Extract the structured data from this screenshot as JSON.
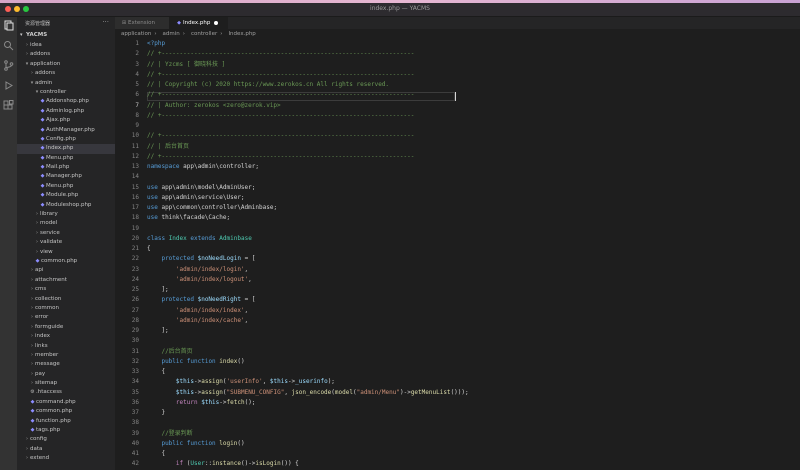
{
  "window": {
    "title": "index.php — YACMS"
  },
  "activity_icons": [
    "files-icon",
    "search-icon",
    "source-control-icon",
    "run-debug-icon",
    "extensions-icon"
  ],
  "sidebar": {
    "title": "资源管理器",
    "root": "YACMS",
    "items": [
      {
        "label": "idea",
        "depth": 1,
        "type": "folder",
        "open": false
      },
      {
        "label": "addons",
        "depth": 1,
        "type": "folder",
        "open": false
      },
      {
        "label": "application",
        "depth": 1,
        "type": "folder",
        "open": true
      },
      {
        "label": "addons",
        "depth": 2,
        "type": "folder",
        "open": false
      },
      {
        "label": "admin",
        "depth": 2,
        "type": "folder",
        "open": true
      },
      {
        "label": "controller",
        "depth": 3,
        "type": "folder",
        "open": true
      },
      {
        "label": "Addonshop.php",
        "depth": 4,
        "type": "php"
      },
      {
        "label": "Adminlog.php",
        "depth": 4,
        "type": "php"
      },
      {
        "label": "Ajax.php",
        "depth": 4,
        "type": "php"
      },
      {
        "label": "AuthManager.php",
        "depth": 4,
        "type": "php"
      },
      {
        "label": "Config.php",
        "depth": 4,
        "type": "php"
      },
      {
        "label": "Index.php",
        "depth": 4,
        "type": "php",
        "selected": true
      },
      {
        "label": "Menu.php",
        "depth": 4,
        "type": "php"
      },
      {
        "label": "Mail.php",
        "depth": 4,
        "type": "php"
      },
      {
        "label": "Manager.php",
        "depth": 4,
        "type": "php"
      },
      {
        "label": "Menu.php",
        "depth": 4,
        "type": "php"
      },
      {
        "label": "Module.php",
        "depth": 4,
        "type": "php"
      },
      {
        "label": "Moduleshop.php",
        "depth": 4,
        "type": "php"
      },
      {
        "label": "library",
        "depth": 3,
        "type": "folder",
        "open": false
      },
      {
        "label": "model",
        "depth": 3,
        "type": "folder",
        "open": false
      },
      {
        "label": "service",
        "depth": 3,
        "type": "folder",
        "open": false
      },
      {
        "label": "validate",
        "depth": 3,
        "type": "folder",
        "open": false
      },
      {
        "label": "view",
        "depth": 3,
        "type": "folder",
        "open": false
      },
      {
        "label": "common.php",
        "depth": 3,
        "type": "php"
      },
      {
        "label": "api",
        "depth": 2,
        "type": "folder",
        "open": false
      },
      {
        "label": "attachment",
        "depth": 2,
        "type": "folder",
        "open": false
      },
      {
        "label": "cms",
        "depth": 2,
        "type": "folder",
        "open": false
      },
      {
        "label": "collection",
        "depth": 2,
        "type": "folder",
        "open": false
      },
      {
        "label": "common",
        "depth": 2,
        "type": "folder",
        "open": false
      },
      {
        "label": "error",
        "depth": 2,
        "type": "folder",
        "open": false
      },
      {
        "label": "formguide",
        "depth": 2,
        "type": "folder",
        "open": false
      },
      {
        "label": "index",
        "depth": 2,
        "type": "folder",
        "open": false
      },
      {
        "label": "links",
        "depth": 2,
        "type": "folder",
        "open": false
      },
      {
        "label": "member",
        "depth": 2,
        "type": "folder",
        "open": false
      },
      {
        "label": "message",
        "depth": 2,
        "type": "folder",
        "open": false
      },
      {
        "label": "pay",
        "depth": 2,
        "type": "folder",
        "open": false
      },
      {
        "label": "sitemap",
        "depth": 2,
        "type": "folder",
        "open": false
      },
      {
        "label": ".htaccess",
        "depth": 2,
        "type": "file"
      },
      {
        "label": "command.php",
        "depth": 2,
        "type": "php"
      },
      {
        "label": "common.php",
        "depth": 2,
        "type": "php"
      },
      {
        "label": "function.php",
        "depth": 2,
        "type": "php"
      },
      {
        "label": "tags.php",
        "depth": 2,
        "type": "php"
      },
      {
        "label": "config",
        "depth": 1,
        "type": "folder",
        "open": false
      },
      {
        "label": "data",
        "depth": 1,
        "type": "folder",
        "open": false
      },
      {
        "label": "extend",
        "depth": 1,
        "type": "folder",
        "open": false
      }
    ]
  },
  "tabs": [
    {
      "label": "Extension",
      "active": false,
      "modified": false
    },
    {
      "label": "Index.php",
      "active": true,
      "modified": true
    }
  ],
  "breadcrumb": [
    "application",
    "admin",
    "controller",
    "Index.php"
  ],
  "colors": {
    "keyword": "#569cd6",
    "control": "#c586c0",
    "string": "#ce9178",
    "comment": "#6a9955",
    "variable": "#9cdcfe",
    "class": "#4ec9b0",
    "function": "#dcdcaa",
    "text": "#d4d4d4"
  },
  "editor": {
    "active_line": 6,
    "lines": [
      {
        "n": "1",
        "tokens": [
          [
            "keyword",
            "<?php"
          ]
        ]
      },
      {
        "n": "2",
        "tokens": [
          [
            "comment",
            "// +----------------------------------------------------------------------"
          ]
        ]
      },
      {
        "n": "3",
        "tokens": [
          [
            "comment",
            "// | Yzcms [ 御晓科技 ]"
          ]
        ]
      },
      {
        "n": "4",
        "tokens": [
          [
            "comment",
            "// +----------------------------------------------------------------------"
          ]
        ]
      },
      {
        "n": "5",
        "tokens": [
          [
            "comment",
            "// | Copyright (c) 2020 https://www.zerokos.cn All rights reserved."
          ]
        ]
      },
      {
        "n": "6",
        "tokens": [
          [
            "comment",
            "// +----------------------------------------------------------------------"
          ]
        ]
      },
      {
        "n": "7",
        "tokens": [
          [
            "comment",
            "// | Author: zerokos <zero@zerok.vip>"
          ]
        ]
      },
      {
        "n": "8",
        "tokens": [
          [
            "comment",
            "// +----------------------------------------------------------------------"
          ]
        ]
      },
      {
        "n": "9",
        "tokens": []
      },
      {
        "n": "10",
        "tokens": [
          [
            "comment",
            "// +----------------------------------------------------------------------"
          ]
        ]
      },
      {
        "n": "11",
        "tokens": [
          [
            "comment",
            "// | 后台首页"
          ]
        ]
      },
      {
        "n": "12",
        "tokens": [
          [
            "comment",
            "// +----------------------------------------------------------------------"
          ]
        ]
      },
      {
        "n": "13",
        "tokens": [
          [
            "keyword",
            "namespace"
          ],
          [
            "text",
            " app\\admin\\controller;"
          ]
        ]
      },
      {
        "n": "14",
        "tokens": []
      },
      {
        "n": "15",
        "tokens": [
          [
            "keyword",
            "use"
          ],
          [
            "text",
            " app\\admin\\model\\AdminUser;"
          ]
        ]
      },
      {
        "n": "16",
        "tokens": [
          [
            "keyword",
            "use"
          ],
          [
            "text",
            " app\\admin\\service\\User;"
          ]
        ]
      },
      {
        "n": "17",
        "tokens": [
          [
            "keyword",
            "use"
          ],
          [
            "text",
            " app\\common\\controller\\Adminbase;"
          ]
        ]
      },
      {
        "n": "18",
        "tokens": [
          [
            "keyword",
            "use"
          ],
          [
            "text",
            " think\\facade\\Cache;"
          ]
        ]
      },
      {
        "n": "19",
        "tokens": []
      },
      {
        "n": "20",
        "tokens": [
          [
            "keyword",
            "class"
          ],
          [
            "text",
            " "
          ],
          [
            "class",
            "Index"
          ],
          [
            "text",
            " "
          ],
          [
            "keyword",
            "extends"
          ],
          [
            "text",
            " "
          ],
          [
            "class",
            "Adminbase"
          ]
        ]
      },
      {
        "n": "21",
        "tokens": [
          [
            "text",
            "{"
          ]
        ]
      },
      {
        "n": "22",
        "tokens": [
          [
            "text",
            "    "
          ],
          [
            "keyword",
            "protected"
          ],
          [
            "text",
            " "
          ],
          [
            "variable",
            "$noNeedLogin"
          ],
          [
            "text",
            " = ["
          ]
        ]
      },
      {
        "n": "23",
        "tokens": [
          [
            "text",
            "        "
          ],
          [
            "string",
            "'admin/index/login'"
          ],
          [
            "text",
            ","
          ]
        ]
      },
      {
        "n": "24",
        "tokens": [
          [
            "text",
            "        "
          ],
          [
            "string",
            "'admin/index/logout'"
          ],
          [
            "text",
            ","
          ]
        ]
      },
      {
        "n": "25",
        "tokens": [
          [
            "text",
            "    ];"
          ]
        ]
      },
      {
        "n": "26",
        "tokens": [
          [
            "text",
            "    "
          ],
          [
            "keyword",
            "protected"
          ],
          [
            "text",
            " "
          ],
          [
            "variable",
            "$noNeedRight"
          ],
          [
            "text",
            " = ["
          ]
        ]
      },
      {
        "n": "27",
        "tokens": [
          [
            "text",
            "        "
          ],
          [
            "string",
            "'admin/index/index'"
          ],
          [
            "text",
            ","
          ]
        ]
      },
      {
        "n": "28",
        "tokens": [
          [
            "text",
            "        "
          ],
          [
            "string",
            "'admin/index/cache'"
          ],
          [
            "text",
            ","
          ]
        ]
      },
      {
        "n": "29",
        "tokens": [
          [
            "text",
            "    ];"
          ]
        ]
      },
      {
        "n": "30",
        "tokens": []
      },
      {
        "n": "31",
        "tokens": [
          [
            "text",
            "    "
          ],
          [
            "comment",
            "//后台首页"
          ]
        ]
      },
      {
        "n": "32",
        "tokens": [
          [
            "text",
            "    "
          ],
          [
            "keyword",
            "public"
          ],
          [
            "text",
            " "
          ],
          [
            "keyword",
            "function"
          ],
          [
            "text",
            " "
          ],
          [
            "function",
            "index"
          ],
          [
            "text",
            "()"
          ]
        ]
      },
      {
        "n": "33",
        "tokens": [
          [
            "text",
            "    {"
          ]
        ]
      },
      {
        "n": "34",
        "tokens": [
          [
            "text",
            "        "
          ],
          [
            "variable",
            "$this"
          ],
          [
            "text",
            "->"
          ],
          [
            "function",
            "assign"
          ],
          [
            "text",
            "("
          ],
          [
            "string",
            "'userInfo'"
          ],
          [
            "text",
            ", "
          ],
          [
            "variable",
            "$this"
          ],
          [
            "text",
            "->"
          ],
          [
            "variable",
            "_userinfo"
          ],
          [
            "text",
            ");"
          ]
        ]
      },
      {
        "n": "35",
        "tokens": [
          [
            "text",
            "        "
          ],
          [
            "variable",
            "$this"
          ],
          [
            "text",
            "->"
          ],
          [
            "function",
            "assign"
          ],
          [
            "text",
            "("
          ],
          [
            "string",
            "\"SUBMENU_CONFIG\""
          ],
          [
            "text",
            ", "
          ],
          [
            "function",
            "json_encode"
          ],
          [
            "text",
            "("
          ],
          [
            "function",
            "model"
          ],
          [
            "text",
            "("
          ],
          [
            "string",
            "\"admin/Menu\""
          ],
          [
            "text",
            ")->"
          ],
          [
            "function",
            "getMenuList"
          ],
          [
            "text",
            "()));"
          ]
        ]
      },
      {
        "n": "36",
        "tokens": [
          [
            "text",
            "        "
          ],
          [
            "control",
            "return"
          ],
          [
            "text",
            " "
          ],
          [
            "variable",
            "$this"
          ],
          [
            "text",
            "->"
          ],
          [
            "function",
            "fetch"
          ],
          [
            "text",
            "();"
          ]
        ]
      },
      {
        "n": "37",
        "tokens": [
          [
            "text",
            "    }"
          ]
        ]
      },
      {
        "n": "38",
        "tokens": []
      },
      {
        "n": "39",
        "tokens": [
          [
            "text",
            "    "
          ],
          [
            "comment",
            "//登录判断"
          ]
        ]
      },
      {
        "n": "40",
        "tokens": [
          [
            "text",
            "    "
          ],
          [
            "keyword",
            "public"
          ],
          [
            "text",
            " "
          ],
          [
            "keyword",
            "function"
          ],
          [
            "text",
            " "
          ],
          [
            "function",
            "login"
          ],
          [
            "text",
            "()"
          ]
        ]
      },
      {
        "n": "41",
        "tokens": [
          [
            "text",
            "    {"
          ]
        ]
      },
      {
        "n": "42",
        "tokens": [
          [
            "text",
            "        "
          ],
          [
            "control",
            "if"
          ],
          [
            "text",
            " ("
          ],
          [
            "class",
            "User"
          ],
          [
            "text",
            "::"
          ],
          [
            "function",
            "instance"
          ],
          [
            "text",
            "()->"
          ],
          [
            "function",
            "isLogin"
          ],
          [
            "text",
            "()) {"
          ]
        ]
      }
    ]
  }
}
